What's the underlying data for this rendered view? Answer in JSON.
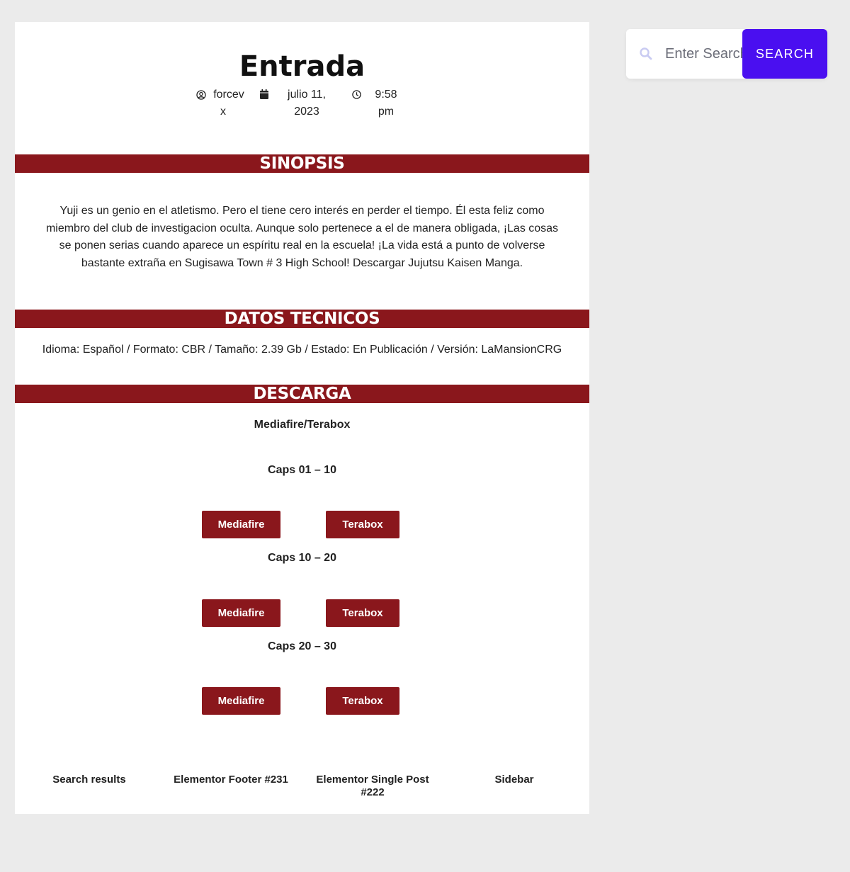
{
  "post": {
    "title": "Entrada",
    "author_line1": "forcev",
    "author_line2": "x",
    "date_line1": "julio 11,",
    "date_line2": "2023",
    "time_line1": "9:58",
    "time_line2": "pm"
  },
  "sections": {
    "sinopsis": "SINOPSIS",
    "datos": "DATOS TECNICOS",
    "descarga": "DESCARGA"
  },
  "synopsis": {
    "line1": "Yuji es un genio en el atletismo. Pero el tiene cero interés en perder el tiempo. Él esta feliz como",
    "line2": "miembro del club de investigacion oculta. Aunque solo pertenece a el de manera obligada, ¡Las cosas",
    "line3": "se ponen serias cuando aparece un espíritu real en la escuela! ¡La vida está a punto de volverse",
    "line4": "bastante extraña en Sugisawa Town # 3 High School! Descargar Jujutsu Kaisen Manga."
  },
  "datos_text": "Idioma: Español / Formato: CBR / Tamaño: 2.39 Gb / Estado: En Publicación / Versión: LaMansionCRG",
  "download": {
    "hosts": "Mediafire/Terabox",
    "groups": [
      {
        "caps": "Caps 01 – 10",
        "btn1": "Mediafire",
        "btn2": "Terabox"
      },
      {
        "caps": "Caps 10 – 20",
        "btn1": "Mediafire",
        "btn2": "Terabox"
      },
      {
        "caps": "Caps 20 – 30",
        "btn1": "Mediafire",
        "btn2": "Terabox"
      }
    ]
  },
  "footer_links": {
    "search_results": "Search results",
    "elementor_footer": "Elementor Footer #231",
    "single_post_line1": "Elementor Single Post",
    "single_post_line2": "#222",
    "sidebar": "Sidebar"
  },
  "search": {
    "placeholder": "Enter Search",
    "button": "SEARCH"
  },
  "colors": {
    "band": "#8a171c",
    "search_button": "#4a0ff0",
    "page_bg": "#ebebeb"
  },
  "icons": [
    "user-circle-icon",
    "calendar-icon",
    "clock-icon",
    "search-icon"
  ]
}
